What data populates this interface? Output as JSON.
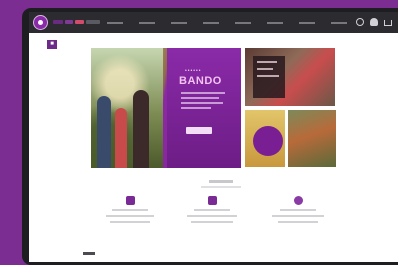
{
  "header": {
    "brand_colors": [
      "#7e2c96",
      "#9b4bb4",
      "#d64a6c",
      "#8a8a90"
    ],
    "nav_count": 8,
    "icons": [
      "search-icon",
      "account-icon",
      "cart-icon"
    ]
  },
  "hero": {
    "promo_text": "BANDO",
    "accent_color": "#7a1f93"
  },
  "colors": {
    "background": "#7b2d92",
    "frame": "#1e1e22",
    "accent": "#8a2aa8"
  }
}
